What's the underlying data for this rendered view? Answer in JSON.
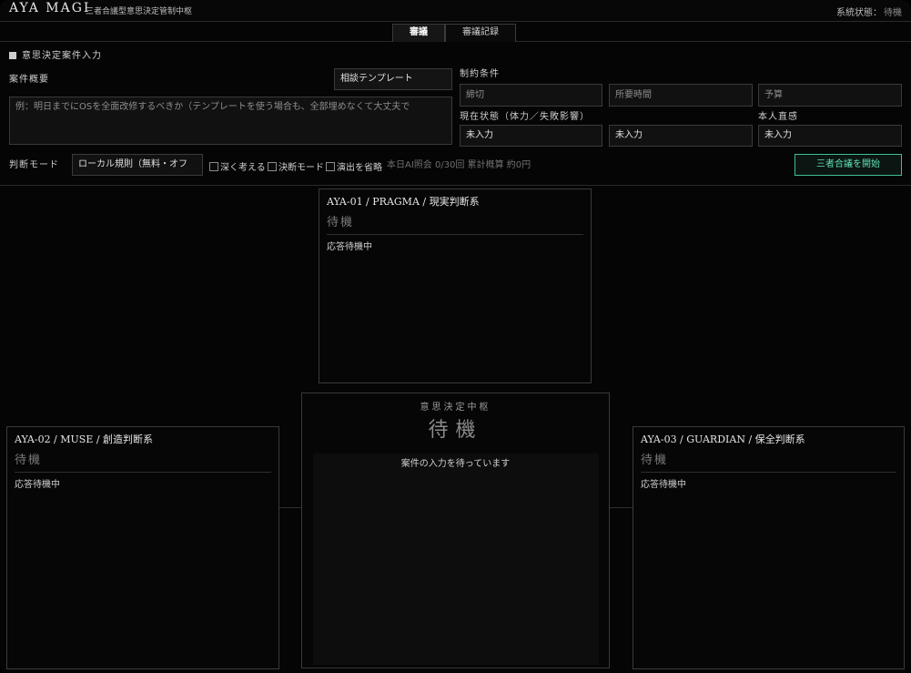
{
  "header": {
    "title": "AYA MAGI",
    "subtitle": "三者合議型意思決定管制中枢",
    "status_label": "系統状態：",
    "status_value": "待機"
  },
  "tabs": [
    {
      "label": "審議",
      "active": true
    },
    {
      "label": "審議記録",
      "active": false
    }
  ],
  "form": {
    "heading": "意思決定案件入力",
    "summary_label": "案件概要",
    "template_label": "相談テンプレート",
    "summary_placeholder": "例：明日までにOSを全面改修するべきか（テンプレートを使う場合も、全部埋めなくて大丈夫で",
    "constraints_label": "制約条件",
    "deadline_placeholder": "締切",
    "required_time_placeholder": "所要時間",
    "budget_placeholder": "予算",
    "current_state_label": "現在状態（体力／失敗影響）",
    "intuition_label": "本人直感",
    "current_state_value": "未入力",
    "failure_impact_value": "未入力",
    "intuition_value": "未入力",
    "mode_label": "判断モード",
    "mode_value": "ローカル規則（無料・オフ",
    "options": [
      {
        "label": "深く考える",
        "checked": false
      },
      {
        "label": "決断モード",
        "checked": false
      },
      {
        "label": "演出を省略",
        "checked": false
      }
    ],
    "quota_text": "本日AI照会 0/30回 累計概算 約0円",
    "start_button": "三者合議を開始"
  },
  "nodes": {
    "pragma": {
      "title": "AYA-01 / PRAGMA / 現実判断系",
      "state": "待機",
      "response": "応答待機中"
    },
    "muse": {
      "title": "AYA-02 / MUSE / 創造判断系",
      "state": "待機",
      "response": "応答待機中"
    },
    "guardian": {
      "title": "AYA-03 / GUARDIAN / 保全判断系",
      "state": "待機",
      "response": "応答待機中"
    }
  },
  "core": {
    "label": "意思決定中枢",
    "state": "待機",
    "message": "案件の入力を待っています"
  },
  "colors": {
    "accent": "#3fbf96",
    "background": "#050505",
    "border": "#3a3a3a"
  }
}
